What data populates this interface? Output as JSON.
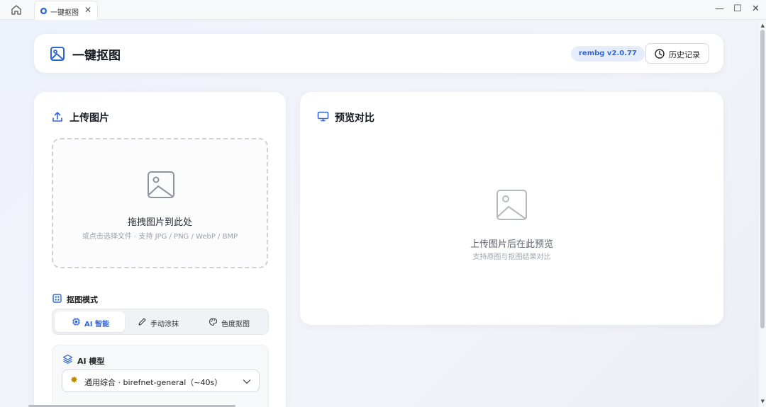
{
  "browser": {
    "tab_title": "一键抠图",
    "tab_close": "✕",
    "minimize": "—",
    "maximize": "☐",
    "close": "✕"
  },
  "header": {
    "title": "一键抠图",
    "version": "rembg v2.0.77",
    "history_label": "历史记录"
  },
  "upload": {
    "title": "上传图片",
    "drop_title": "拖拽图片到此处",
    "drop_subtitle": "或点击选择文件 · 支持 JPG / PNG / WebP / BMP"
  },
  "mode": {
    "title": "抠图模式",
    "tabs": [
      {
        "label": "AI 智能",
        "icon": "chip-icon",
        "active": true
      },
      {
        "label": "手动涂抹",
        "icon": "pencil-icon",
        "active": false
      },
      {
        "label": "色度抠图",
        "icon": "palette-icon",
        "active": false
      }
    ]
  },
  "model": {
    "title": "AI 模型",
    "selected_emoji": "✸",
    "selected": "通用综合 · birefnet-general（~40s）"
  },
  "preview": {
    "title": "预览对比",
    "placeholder_title": "上传图片后在此预览",
    "placeholder_subtitle": "支持原图与抠图结果对比"
  },
  "colors": {
    "accent": "#2f65d8",
    "badge_bg": "#e5edfb",
    "page_bg": "#eef1f8"
  }
}
